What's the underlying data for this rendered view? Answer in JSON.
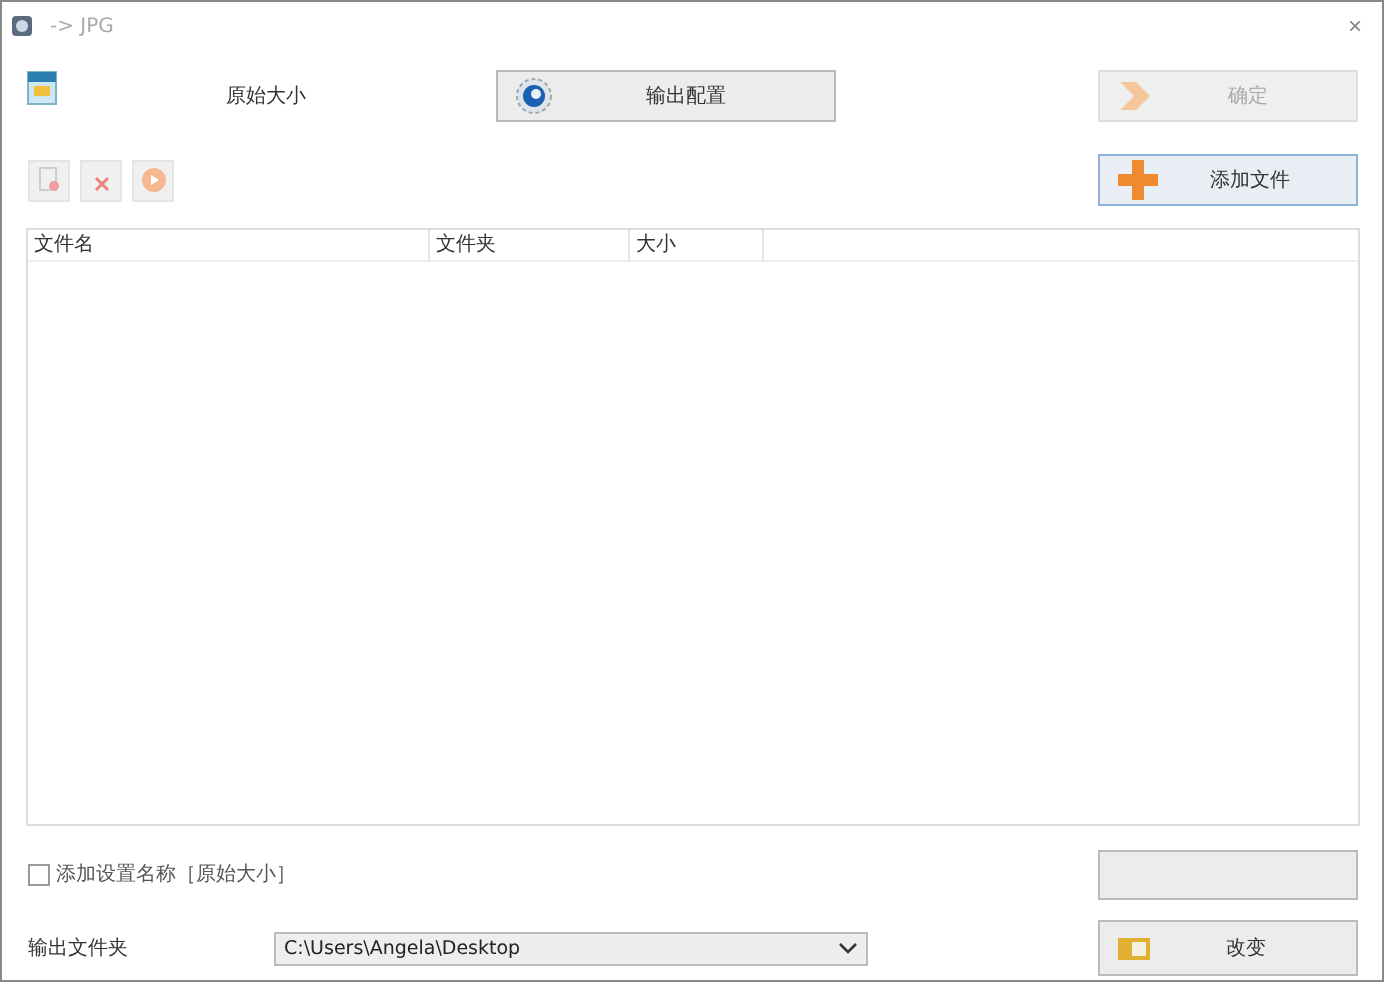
{
  "window": {
    "title": "-> JPG",
    "close": "×"
  },
  "top": {
    "preset": "原始大小",
    "config_button": "输出配置",
    "ok_button": {
      "label": "确定",
      "disabled": true
    },
    "add_button": "添加文件"
  },
  "table": {
    "columns": [
      "文件名",
      "文件夹",
      "大小"
    ]
  },
  "add_name": {
    "label": "添加设置名称［原始大小］",
    "checked": false
  },
  "output": {
    "label": "输出文件夹",
    "path": "C:\\Users\\Angela\\Desktop",
    "change_button": "改变"
  }
}
